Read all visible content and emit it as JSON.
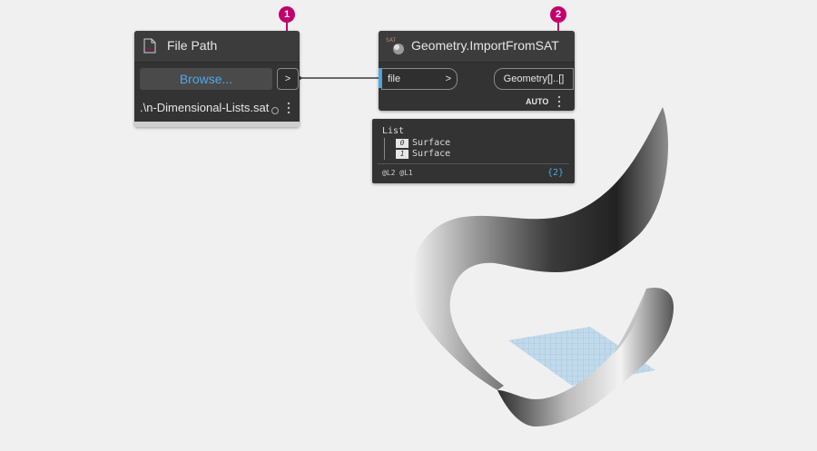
{
  "colors": {
    "canvas_bg": "#f0f0f0",
    "node_bg": "#333333",
    "node_header": "#3c3c3c",
    "callout": "#c2006b",
    "accent_blue": "#4ea7e6",
    "wire": "#3a3a3a"
  },
  "callouts": [
    "1",
    "2"
  ],
  "file_path_node": {
    "title": "File Path",
    "icon": "file-icon",
    "browse_label": "Browse...",
    "output_port": ">",
    "value": ".\\n-Dimensional-Lists.sat",
    "menu_icon": "more-vertical-icon"
  },
  "import_node": {
    "title": "Geometry.ImportFromSAT",
    "icon": "sat-geometry-icon",
    "icon_text": "SAT",
    "input_label": "file",
    "input_arrow": ">",
    "output_label": "Geometry[]..[]",
    "lacing": "AUTO",
    "menu_icon": "more-vertical-icon"
  },
  "watch_panel": {
    "header": "List",
    "items": [
      {
        "index": "0",
        "label": "Surface"
      },
      {
        "index": "1",
        "label": "Surface"
      }
    ],
    "levels": "@L2 @L1",
    "count": "{2}"
  }
}
